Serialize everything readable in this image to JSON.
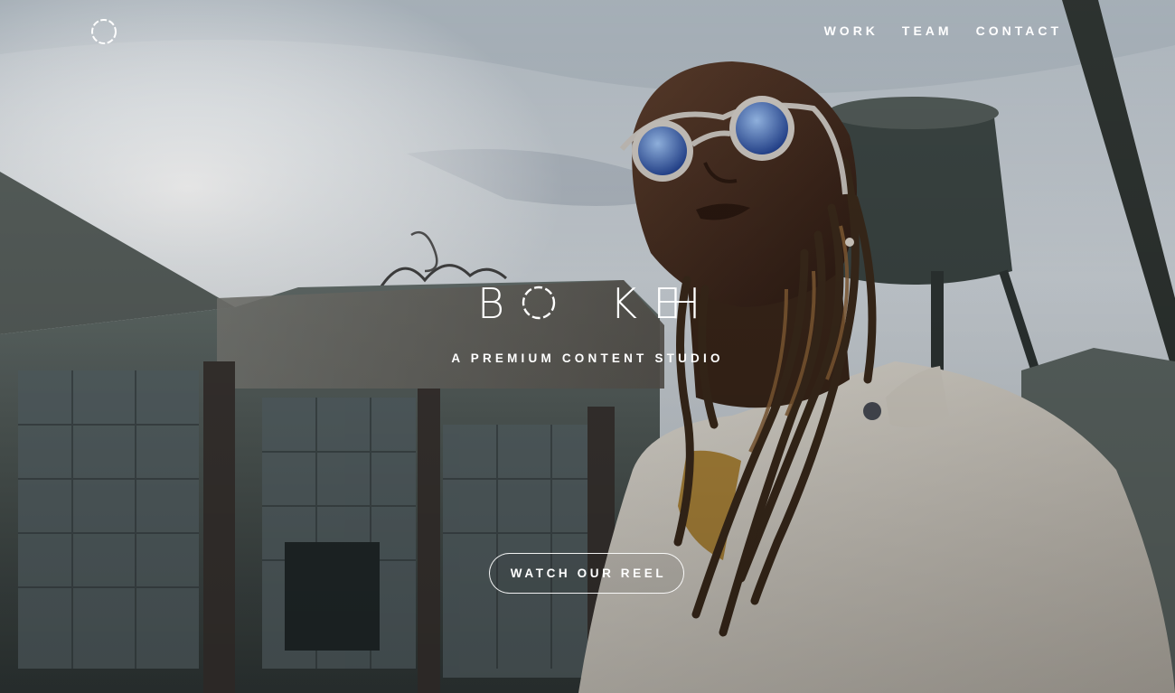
{
  "nav": {
    "logo_icon": "ring-logo-icon",
    "links": [
      "WORK",
      "TEAM",
      "CONTACT"
    ]
  },
  "hero": {
    "brand_letters": [
      "B",
      "O",
      "K",
      "E",
      "H"
    ],
    "tagline": "A PREMIUM CONTENT STUDIO",
    "cta_label": "WATCH OUR REEL"
  },
  "colors": {
    "text": "#ffffff",
    "sky": "#d4dbe1",
    "building": "#4d5755"
  }
}
